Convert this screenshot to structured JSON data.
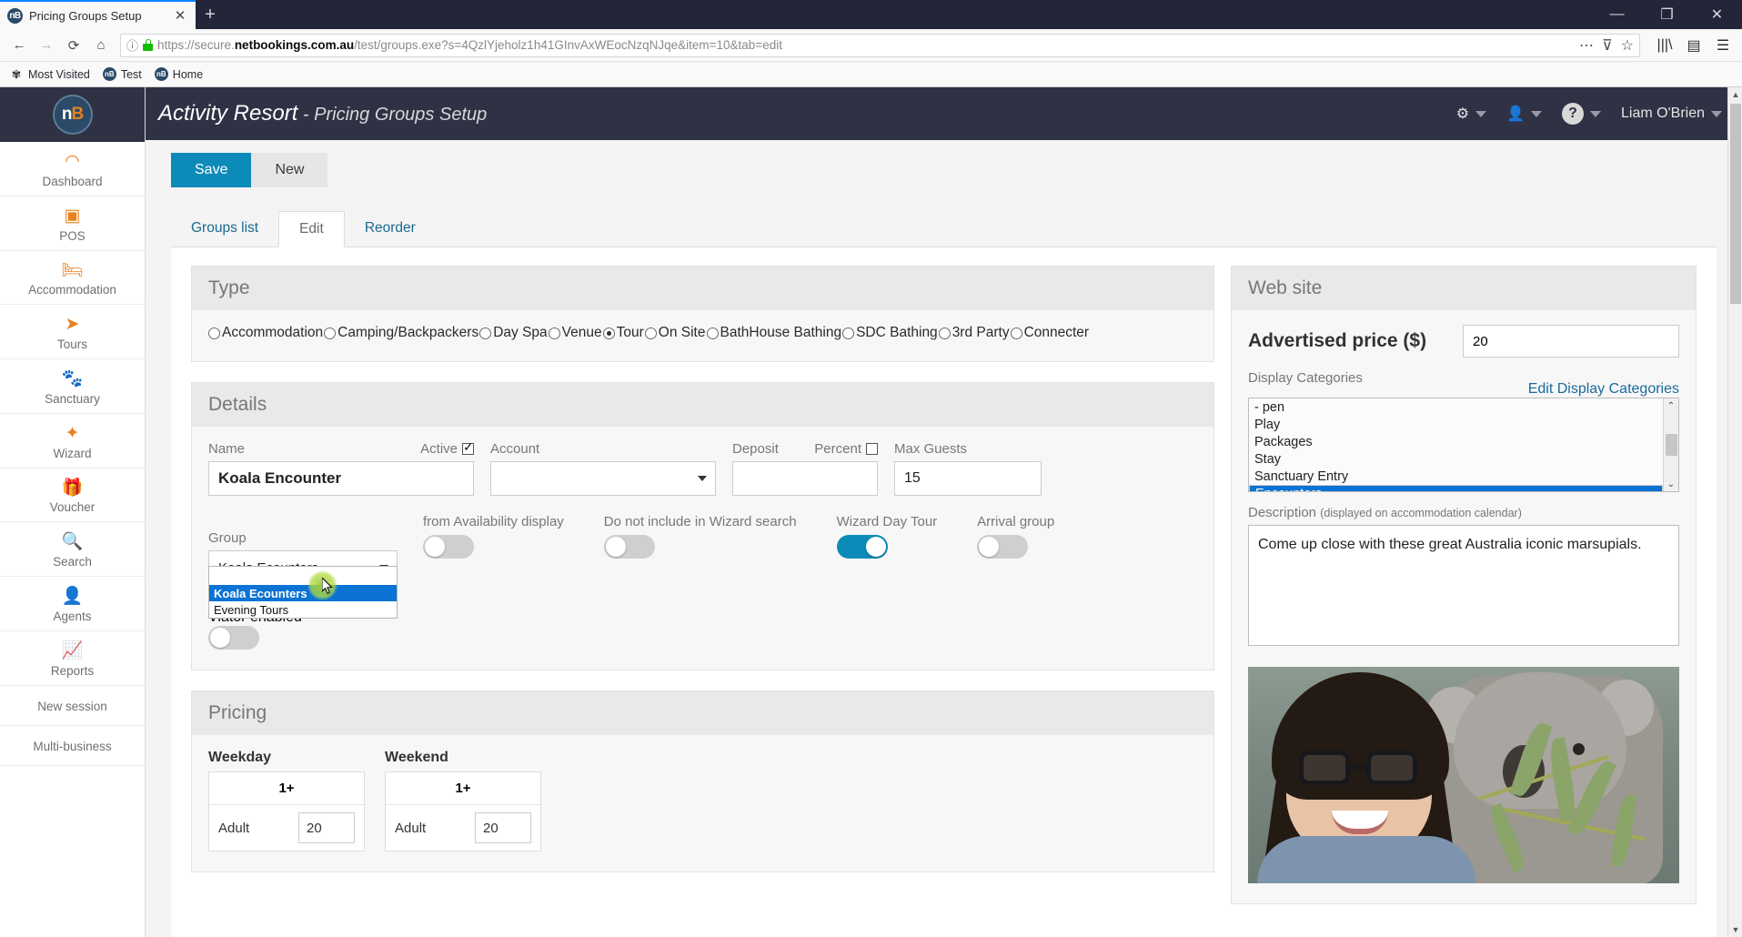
{
  "browser": {
    "tab": {
      "title": "Pricing Groups Setup",
      "favicon_label": "nB",
      "close_icon": "✕"
    },
    "new_tab_icon": "+",
    "window_controls": {
      "minimize": "—",
      "maximize": "❐",
      "close": "✕"
    },
    "nav": {
      "back": "←",
      "forward": "→",
      "reload": "⟳",
      "home": "⌂"
    },
    "url": {
      "scheme": "https://secure.",
      "domain": "netbookings.com.au",
      "path": "/test/groups.exe?s=4QzlYjeholz1h41GInvAxWEocNzqNJqe&item=10&tab=edit",
      "identity_icon": "ⓘ",
      "menu_icon": "⋯",
      "pocket_icon": "⊽",
      "star_icon": "☆"
    },
    "toolbar_icons": {
      "library": "|||\\",
      "sidebar": "▤",
      "menu": "☰"
    },
    "bookmarks": [
      {
        "label": "Most Visited",
        "icon": "✾"
      },
      {
        "label": "Test",
        "icon": "nB"
      },
      {
        "label": "Home",
        "icon": "nB"
      }
    ]
  },
  "sidebar": {
    "logo": {
      "prefix": "n",
      "suffix": "B"
    },
    "items": [
      {
        "label": "Dashboard",
        "icon": "◠"
      },
      {
        "label": "POS",
        "icon": "▣"
      },
      {
        "label": "Accommodation",
        "icon": "🛏"
      },
      {
        "label": "Tours",
        "icon": "✈"
      },
      {
        "label": "Sanctuary",
        "icon": "🐨"
      },
      {
        "label": "Wizard",
        "icon": "✦"
      },
      {
        "label": "Voucher",
        "icon": "🎁"
      },
      {
        "label": "Search",
        "icon": "🔍"
      },
      {
        "label": "Agents",
        "icon": "👤"
      },
      {
        "label": "Reports",
        "icon": "📈"
      }
    ],
    "plain_items": [
      {
        "label": "New session"
      },
      {
        "label": "Multi-business"
      }
    ]
  },
  "appbar": {
    "business": "Activity Resort",
    "separator": " - ",
    "page": "Pricing Groups Setup",
    "gear_icon": "⚙",
    "user_icon": "👤",
    "help_icon": "?",
    "username": "Liam O'Brien"
  },
  "toolbar": {
    "save_label": "Save",
    "new_label": "New"
  },
  "tabs": [
    {
      "label": "Groups list",
      "active": false
    },
    {
      "label": "Edit",
      "active": true
    },
    {
      "label": "Reorder",
      "active": false
    }
  ],
  "type_card": {
    "title": "Type",
    "options": [
      {
        "label": "Accommodation",
        "checked": false
      },
      {
        "label": "Camping/Backpackers",
        "checked": false
      },
      {
        "label": "Day Spa",
        "checked": false
      },
      {
        "label": "Venue",
        "checked": false
      },
      {
        "label": "Tour",
        "checked": true
      },
      {
        "label": "On Site",
        "checked": false
      },
      {
        "label": "BathHouse Bathing",
        "checked": false
      },
      {
        "label": "SDC Bathing",
        "checked": false
      },
      {
        "label": "3rd Party",
        "checked": false
      },
      {
        "label": "Connecter",
        "checked": false
      }
    ]
  },
  "details_card": {
    "title": "Details",
    "name_label": "Name",
    "name_value": "Koala Encounter",
    "active_label": "Active",
    "active_checked": true,
    "account_label": "Account",
    "account_value": "",
    "deposit_label": "Deposit",
    "deposit_value": "",
    "percent_label": "Percent",
    "percent_checked": false,
    "max_guests_label": "Max Guests",
    "max_guests_value": "15",
    "group_label": "Group",
    "group_value": "Koala Ecounters",
    "group_options": [
      "",
      "Koala Ecounters",
      "Evening Tours"
    ],
    "group_selected": "Koala Ecounters",
    "toggles": [
      {
        "label": "from Availability display",
        "on": false
      },
      {
        "label": "Do not include in Wizard search",
        "on": false
      },
      {
        "label": "Wizard Day Tour",
        "on": true
      },
      {
        "label": "Arrival group",
        "on": false
      }
    ],
    "viator_label": "Viator enabled",
    "viator_on": false
  },
  "pricing_card": {
    "title": "Pricing",
    "tables": [
      {
        "title": "Weekday",
        "column_header": "1+",
        "rows": [
          {
            "name": "Adult",
            "value": "20"
          }
        ]
      },
      {
        "title": "Weekend",
        "column_header": "1+",
        "rows": [
          {
            "name": "Adult",
            "value": "20"
          }
        ]
      }
    ]
  },
  "website_card": {
    "title": "Web site",
    "advertised_price_label": "Advertised price ($)",
    "advertised_price_value": "20",
    "display_categories_label": "Display Categories",
    "edit_categories_link": "Edit Display Categories",
    "categories": [
      {
        "label": "- pen",
        "selected": false
      },
      {
        "label": "Play",
        "selected": false
      },
      {
        "label": "Packages",
        "selected": false
      },
      {
        "label": "Stay",
        "selected": false
      },
      {
        "label": "Sanctuary Entry",
        "selected": false
      },
      {
        "label": "Encounters",
        "selected": true
      }
    ],
    "scroll_up_icon": "⌃",
    "scroll_down_icon": "⌄",
    "description_label": "Description",
    "description_hint": "(displayed on accommodation calendar)",
    "description_value": "Come up close with these great Australia iconic marsupials."
  },
  "colors": {
    "accent_blue": "#0d8bb8",
    "header_dark": "#2e3244",
    "sidebar_icon_orange": "#e8821e",
    "select_blue": "#0a73d4",
    "link_blue": "#1a6a9e"
  }
}
